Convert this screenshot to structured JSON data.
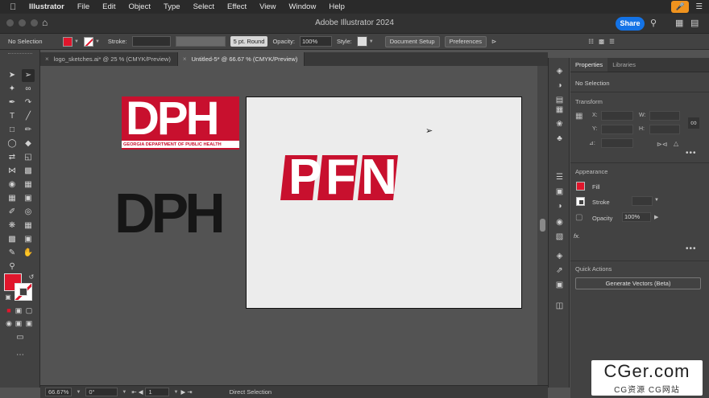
{
  "menubar": {
    "app_name": "Illustrator",
    "items": [
      "File",
      "Edit",
      "Object",
      "Type",
      "Select",
      "Effect",
      "View",
      "Window",
      "Help"
    ]
  },
  "appbar": {
    "title": "Adobe Illustrator 2024",
    "share_label": "Share"
  },
  "control": {
    "selection_label": "No Selection",
    "stroke_label": "Stroke:",
    "brush_label": "5 pt. Round",
    "opacity_label": "Opacity:",
    "opacity_value": "100%",
    "style_label": "Style:",
    "document_setup_label": "Document Setup",
    "preferences_label": "Preferences"
  },
  "tabs": [
    {
      "label": "logo_sketches.ai* @ 25 % (CMYK/Preview)",
      "active": false
    },
    {
      "label": "Untitled-5* @ 66.67 % (CMYK/Preview)",
      "active": true
    }
  ],
  "artwork": {
    "logo_letters": "DPH",
    "logo_subtitle": "GEORGIA DEPARTMENT OF PUBLIC HEALTH",
    "black_letters": "DPH",
    "pfn_letters": [
      "P",
      "F",
      "N"
    ]
  },
  "colors": {
    "brand_red": "#c8102e",
    "fill_red": "#e0162c",
    "accent_blue": "#1473e6"
  },
  "status": {
    "zoom": "66.67%",
    "rotation": "0°",
    "artboard_number": "1",
    "tool": "Direct Selection"
  },
  "panel": {
    "tab_properties": "Properties",
    "tab_libraries": "Libraries",
    "no_selection": "No Selection",
    "transform_heading": "Transform",
    "x_label": "X:",
    "y_label": "Y:",
    "w_label": "W:",
    "h_label": "H:",
    "angle_label": "⊿:",
    "appearance_heading": "Appearance",
    "fill_label": "Fill",
    "stroke_label": "Stroke",
    "opacity_label": "Opacity",
    "opacity_value": "100%",
    "fx_label": "fx.",
    "quick_actions_heading": "Quick Actions",
    "generate_vectors_label": "Generate Vectors (Beta)"
  },
  "watermark": {
    "big": "CGer.com",
    "small": "CG资源 CG网站"
  }
}
